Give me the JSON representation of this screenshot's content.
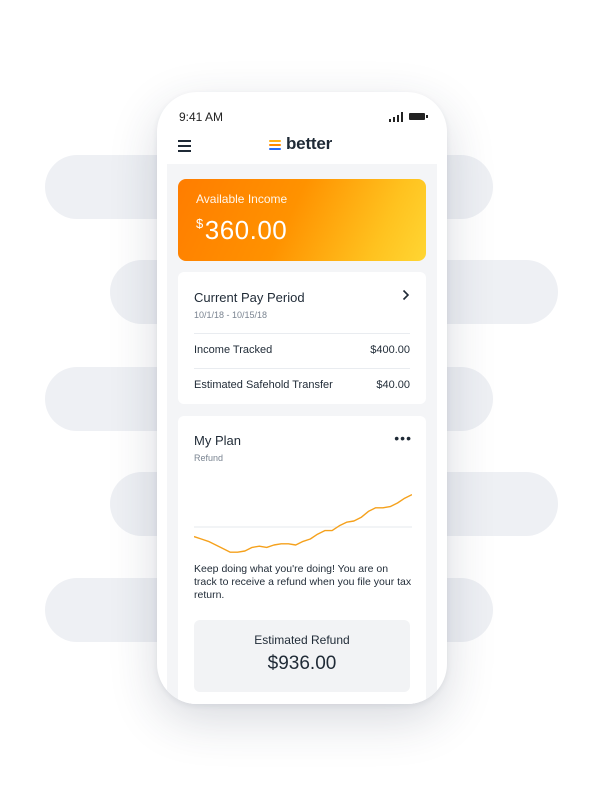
{
  "status_bar": {
    "time": "9:41 AM"
  },
  "header": {
    "brand": "better"
  },
  "income_card": {
    "label": "Available Income",
    "currency": "$",
    "amount": "360.00"
  },
  "pay_period": {
    "title": "Current Pay Period",
    "dates": "10/1/18 - 10/15/18",
    "rows": [
      {
        "label": "Income Tracked",
        "value": "$400.00"
      },
      {
        "label": "Estimated Safehold Transfer",
        "value": "$40.00"
      }
    ]
  },
  "plan": {
    "title": "My Plan",
    "subtitle": "Refund",
    "message": "Keep doing what you're doing! You are on track to receive a refund when you file your tax return.",
    "estimate_label": "Estimated Refund",
    "estimate_value": "$936.00"
  },
  "chart_data": {
    "type": "line",
    "series": [
      {
        "values": [
          -8,
          -10,
          -12,
          -15,
          -18,
          -21,
          -21,
          -20,
          -17,
          -16,
          -17,
          -15,
          -14,
          -14,
          -15,
          -12,
          -10,
          -6,
          -3,
          -3,
          1,
          4,
          5,
          8,
          13,
          16,
          16,
          17,
          20,
          24,
          27
        ]
      }
    ],
    "baseline": 0,
    "ylim": [
      -25,
      35
    ],
    "colors": {
      "line": "#f5a11c",
      "baseline": "#e6e9ee"
    }
  },
  "colors": {
    "accent_orange": "#ff8a00",
    "accent_yellow": "#ffd633",
    "text": "#1f2a36"
  }
}
